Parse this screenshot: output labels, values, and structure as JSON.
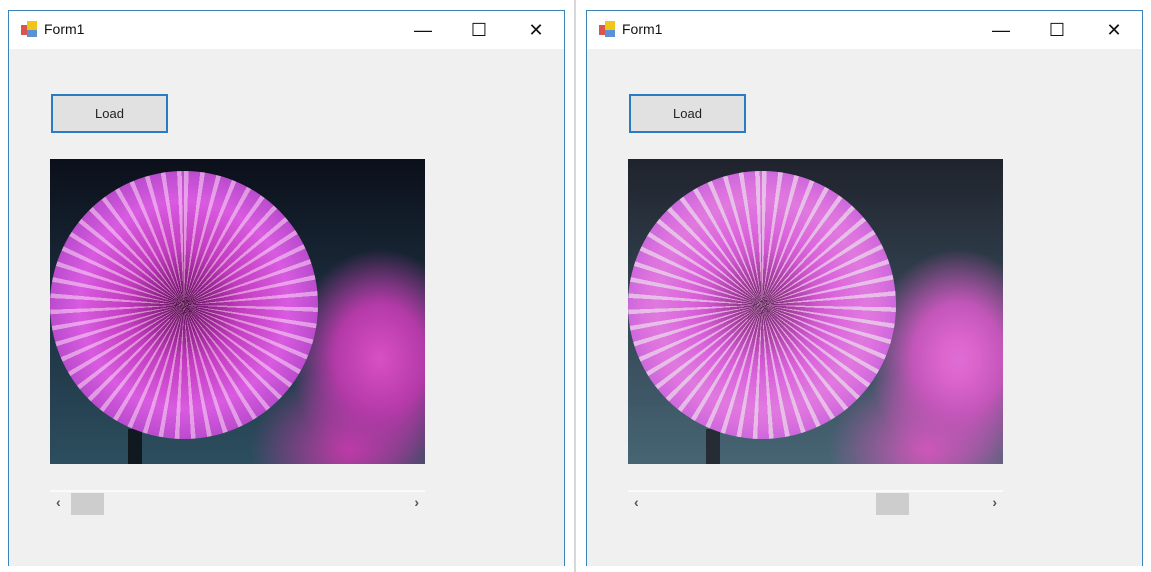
{
  "windows": [
    {
      "title": "Form1",
      "load_label": "Load",
      "scroll_value": 0.0,
      "image": "dandelion-flower-original"
    },
    {
      "title": "Form1",
      "load_label": "Load",
      "scroll_value": 0.76,
      "image": "dandelion-flower-brightened"
    }
  ],
  "icons": {
    "minimize": "—",
    "maximize": "☐",
    "close": "✕",
    "left": "‹",
    "right": "›"
  }
}
